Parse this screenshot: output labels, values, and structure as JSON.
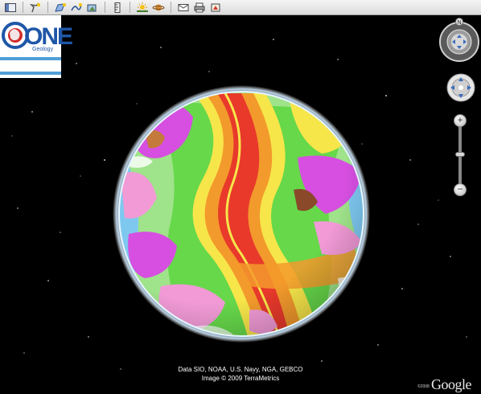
{
  "toolbar": {
    "groups": [
      [
        {
          "icon": "sidebar-icon"
        }
      ],
      [
        {
          "icon": "placemark-icon"
        }
      ],
      [
        {
          "icon": "polygon-icon"
        },
        {
          "icon": "path-icon"
        },
        {
          "icon": "overlay-icon"
        }
      ],
      [
        {
          "icon": "ruler-icon"
        }
      ],
      [
        {
          "icon": "sun-icon"
        },
        {
          "icon": "planet-icon"
        }
      ],
      [
        {
          "icon": "email-icon"
        },
        {
          "icon": "print-icon"
        },
        {
          "icon": "view-in-maps-icon"
        }
      ]
    ]
  },
  "logo": {
    "word": "ONE",
    "subtitle": "Geology"
  },
  "navigation": {
    "north_label": "N",
    "zoom_in": "+",
    "zoom_out": "−"
  },
  "credits": {
    "line1": "Data SIO, NOAA, U.S. Navy, NGA, GEBCO",
    "line2": "Image © 2009 TerraMetrics"
  },
  "google_logo": "Google",
  "small_copyright": "©2008",
  "colors": {
    "ridge_red": "#e8392b",
    "ridge_orange": "#f39a2c",
    "ridge_yellow": "#f7e64a",
    "young_green": "#66d84a",
    "mid_green": "#9fe38a",
    "old_blue": "#7ec8f0",
    "magenta": "#d64fe0",
    "pink": "#f19ad6",
    "space": "#000000"
  }
}
